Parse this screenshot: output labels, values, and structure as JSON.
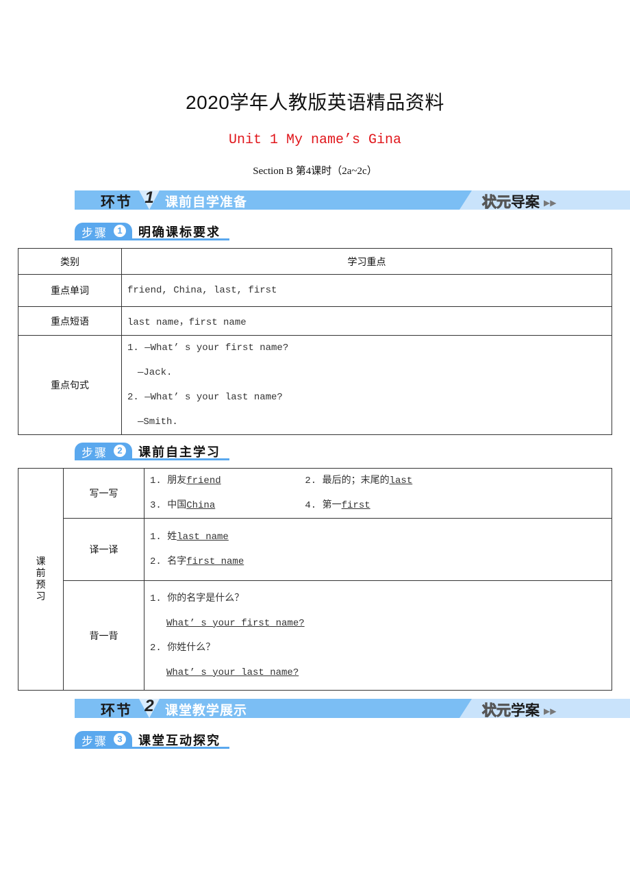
{
  "header": {
    "doc_title": "2020学年人教版英语精品资料",
    "unit_title": "Unit 1 My name’s Gina",
    "section_line": "Section B  第4课时（2a~2c）"
  },
  "banners": [
    {
      "label": "环节",
      "number": "1",
      "title": "课前自学准备",
      "right_outline": "状元",
      "right_bold": "导案",
      "arrows": "▶▶"
    },
    {
      "label": "环节",
      "number": "2",
      "title": "课堂教学展示",
      "right_outline": "状元",
      "right_bold": "学案",
      "arrows": "▶▶"
    }
  ],
  "steps": [
    {
      "label": "步骤",
      "number": "1",
      "title": "明确课标要求"
    },
    {
      "label": "步骤",
      "number": "2",
      "title": "课前自主学习"
    },
    {
      "label": "步骤",
      "number": "3",
      "title": "课堂互动探究"
    }
  ],
  "table1": {
    "headers": [
      "类别",
      "学习重点"
    ],
    "rows": [
      {
        "category": "重点单词",
        "value": "friend, China, last, first"
      },
      {
        "category": "重点短语",
        "value": "last name，first name"
      },
      {
        "category": "重点句式",
        "lines": [
          "1. —What’ s your first name?",
          "—Jack.",
          "2. —What’ s your last name?",
          "—Smith."
        ]
      }
    ]
  },
  "table2": {
    "side_label": "课前预习",
    "write": {
      "label": "写一写",
      "items": [
        {
          "num": "1.",
          "prompt": "朋友",
          "answer": "friend"
        },
        {
          "num": "2.",
          "prompt": "最后的；末尾的",
          "answer": "last"
        },
        {
          "num": "3.",
          "prompt": "中国",
          "answer": "China"
        },
        {
          "num": "4.",
          "prompt": "第一",
          "answer": "first"
        }
      ]
    },
    "translate": {
      "label": "译一译",
      "items": [
        {
          "num": "1.",
          "prompt": "姓",
          "answer": "last name"
        },
        {
          "num": "2.",
          "prompt": "名字",
          "answer": "first name"
        }
      ]
    },
    "recite": {
      "label": "背一背",
      "items": [
        {
          "num": "1.",
          "prompt": "你的名字是什么？",
          "answer": "What’ s your first name?"
        },
        {
          "num": "2.",
          "prompt": "你姓什么？",
          "answer": "What’ s your last name?"
        }
      ]
    }
  }
}
